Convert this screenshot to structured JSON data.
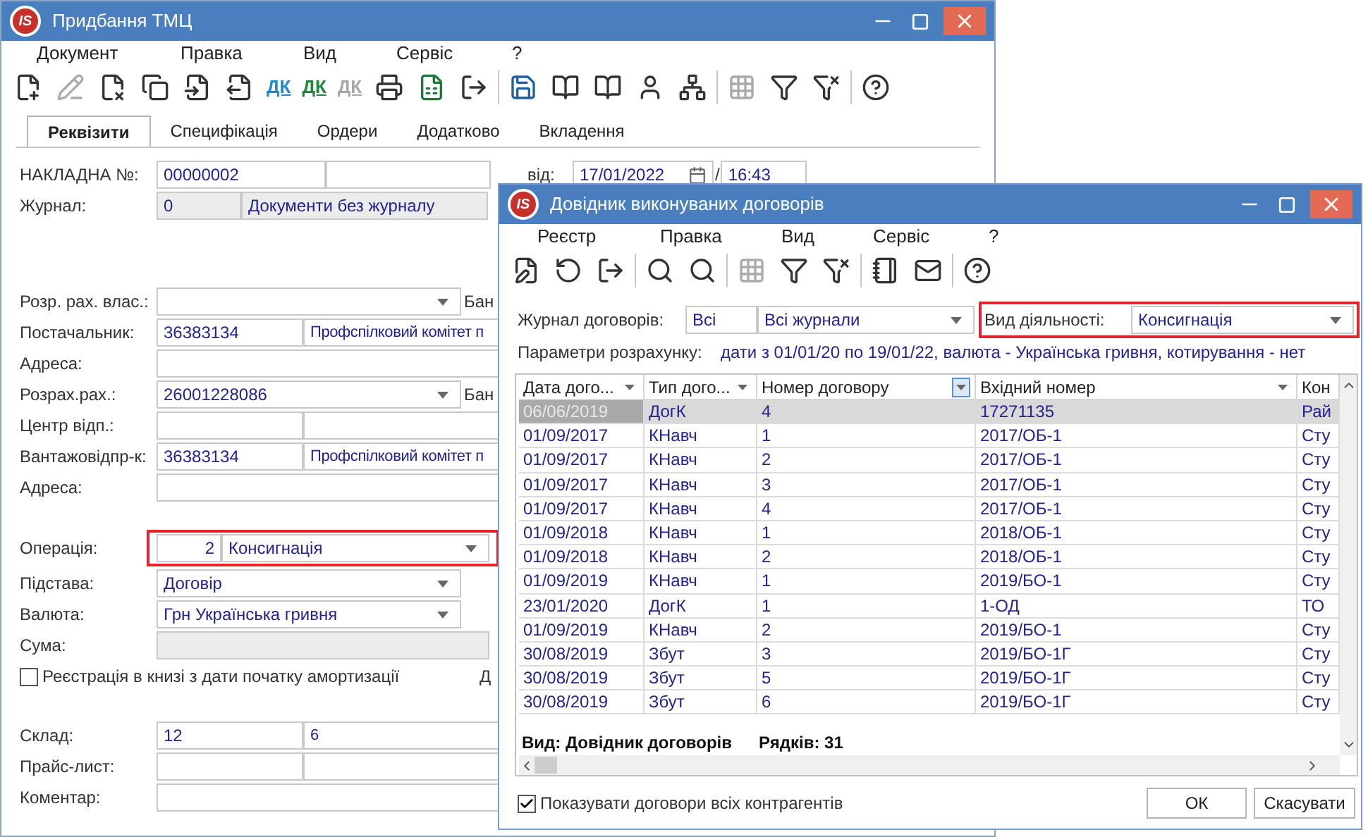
{
  "main_window": {
    "logo": "IS",
    "title": "Придбання ТМЦ",
    "menu": [
      "Документ",
      "Правка",
      "Вид",
      "Сервіс",
      "?"
    ],
    "ledger_buttons": [
      {
        "text": "ДК",
        "color": "#1e88d0"
      },
      {
        "text": "ДК",
        "color": "#1b8a3a"
      },
      {
        "text": "ДК",
        "color": "#a8a8a8"
      }
    ],
    "tabs": [
      {
        "label": "Реквізити",
        "selected": true
      },
      {
        "label": "Специфікація",
        "selected": false
      },
      {
        "label": "Ордери",
        "selected": false
      },
      {
        "label": "Додатково",
        "selected": false
      },
      {
        "label": "Вкладення",
        "selected": false
      }
    ],
    "invoice": {
      "label": "НАКЛАДНА №:",
      "number": "00000002",
      "date_label": "від:",
      "date": "17/01/2022",
      "time_separator": "/",
      "time": "16:43"
    },
    "sections": [
      [
        {
          "kind": "code_pair",
          "label": "Журнал:",
          "values": [
            "0",
            "Документи без журналу"
          ],
          "disabled": true
        }
      ],
      [
        {
          "kind": "combo",
          "label": "Розр. рах. влас.:",
          "side_label": "Бан"
        },
        {
          "kind": "pair",
          "label": "Постачальник:",
          "values": [
            "36383134",
            "Профспілковий комітет п"
          ]
        },
        {
          "kind": "text",
          "label": "Адреса:"
        },
        {
          "kind": "combo",
          "label": "Розрах.рах.:",
          "value": "26001228086",
          "side_label": "Бан"
        },
        {
          "kind": "pair",
          "label": "Центр відп.:"
        },
        {
          "kind": "pair",
          "label": "Вантажовідпр-к:",
          "values": [
            "36383134",
            "Профспілковий комітет п"
          ]
        },
        {
          "kind": "text",
          "label": "Адреса:"
        }
      ],
      [
        {
          "kind": "code_combo",
          "label": "Операція:",
          "code": "2",
          "value": "Консигнація",
          "highlighted": true
        },
        {
          "kind": "combo",
          "label": "Підстава:",
          "value": "Договір"
        },
        {
          "kind": "combo",
          "label": "Валюта:",
          "value": "Грн Українська гривня"
        },
        {
          "kind": "text_short",
          "label": "Сума:",
          "disabled": true
        },
        {
          "kind": "checkbox",
          "label": "Реєстрація в книзі з дати початку амортизації",
          "checked": false,
          "side_label": "Д"
        }
      ],
      [
        {
          "kind": "pair",
          "label": "Склад:",
          "values": [
            "12",
            "6"
          ]
        },
        {
          "kind": "pair",
          "label": "Прайс-лист:"
        },
        {
          "kind": "text",
          "label": "Коментар:"
        }
      ]
    ]
  },
  "dialog": {
    "logo": "IS",
    "title": "Довідник виконуваних договорів",
    "menu": [
      "Реєстр",
      "Правка",
      "Вид",
      "Сервіс",
      "?"
    ],
    "journal": {
      "label": "Журнал договорів:",
      "code": "Всі",
      "value": "Всі журнали"
    },
    "activity": {
      "label": "Вид діяльності:",
      "value": "Консигнація",
      "highlighted": true
    },
    "params": {
      "label": "Параметри розрахунку:",
      "value": "дати з 01/01/20 по 19/01/22, валюта - Українська гривня, котирування - нет"
    },
    "table": {
      "columns": [
        {
          "label": "Дата дого...",
          "filter_active": false
        },
        {
          "label": "Тип дого...",
          "filter_active": false
        },
        {
          "label": "Номер договору",
          "filter_active": true
        },
        {
          "label": "Вхідний номер",
          "filter_active": false
        },
        {
          "label": "Кон"
        }
      ],
      "rows": [
        {
          "cells": [
            "06/06/2019",
            "ДогК",
            "4",
            "17271135",
            "Рай"
          ],
          "selected": true
        },
        {
          "cells": [
            "01/09/2017",
            "КНавч",
            "1",
            "2017/ОБ-1",
            "Сту"
          ],
          "selected": false
        },
        {
          "cells": [
            "01/09/2017",
            "КНавч",
            "2",
            "2017/ОБ-1",
            "Сту"
          ],
          "selected": false
        },
        {
          "cells": [
            "01/09/2017",
            "КНавч",
            "3",
            "2017/ОБ-1",
            "Сту"
          ],
          "selected": false
        },
        {
          "cells": [
            "01/09/2017",
            "КНавч",
            "4",
            "2017/ОБ-1",
            "Сту"
          ],
          "selected": false
        },
        {
          "cells": [
            "01/09/2018",
            "КНавч",
            "1",
            "2018/ОБ-1",
            "Сту"
          ],
          "selected": false
        },
        {
          "cells": [
            "01/09/2018",
            "КНавч",
            "2",
            "2018/ОБ-1",
            "Сту"
          ],
          "selected": false
        },
        {
          "cells": [
            "01/09/2019",
            "КНавч",
            "1",
            "2019/БО-1",
            "Сту"
          ],
          "selected": false
        },
        {
          "cells": [
            "23/01/2020",
            "ДогК",
            "1",
            "1-ОД",
            "ТО"
          ],
          "selected": false
        },
        {
          "cells": [
            "01/09/2019",
            "КНавч",
            "2",
            "2019/БО-1",
            "Сту"
          ],
          "selected": false
        },
        {
          "cells": [
            "30/08/2019",
            "Збут",
            "3",
            "2019/БО-1Г",
            "Сту"
          ],
          "selected": false
        },
        {
          "cells": [
            "30/08/2019",
            "Збут",
            "5",
            "2019/БО-1Г",
            "Сту"
          ],
          "selected": false
        },
        {
          "cells": [
            "30/08/2019",
            "Збут",
            "6",
            "2019/БО-1Г",
            "Сту"
          ],
          "selected": false
        }
      ]
    },
    "footer": {
      "view": "Вид: Довідник договорів",
      "rows": "Рядків: 31"
    },
    "show_all": {
      "label": "Показувати договори всіх контрагентів",
      "checked": true
    },
    "buttons": [
      "ОК",
      "Скасувати"
    ]
  }
}
